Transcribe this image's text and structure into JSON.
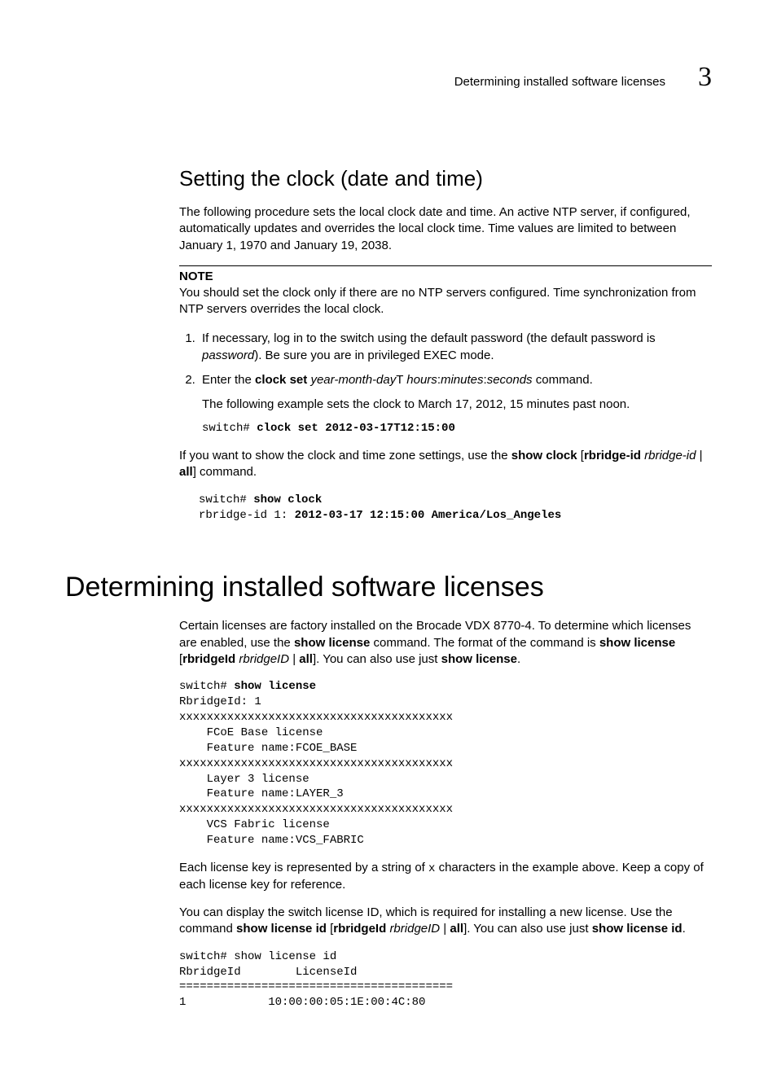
{
  "header": {
    "running_title": "Determining installed software licenses",
    "chapter_number": "3"
  },
  "subsection": {
    "title": "Setting the clock (date and time)",
    "intro": "The following procedure sets the local clock date and time. An active NTP server, if configured, automatically updates and overrides the local clock time. Time values are limited to between January 1, 1970 and January 19, 2038.",
    "note_label": "NOTE",
    "note_body": "You should set the clock only if there are no NTP servers configured. Time synchronization from NTP servers overrides the local clock.",
    "step1_a": "If necessary, log in to the switch using the default password (the default password is ",
    "step1_pw": "password",
    "step1_b": "). Be sure you are in privileged EXEC mode.",
    "step2_a": "Enter the ",
    "step2_cmd": "clock set",
    "step2_b": " ",
    "step2_arg1": "year-month-day",
    "step2_T": "T ",
    "step2_arg2": "hours",
    "step2_colon1": ":",
    "step2_arg3": "minutes",
    "step2_colon2": ":",
    "step2_arg4": "seconds",
    "step2_c": " command.",
    "step2_example_text": "The following example sets the clock to March 17, 2012, 15 minutes past noon.",
    "code1_prompt": "switch# ",
    "code1_cmd": "clock set 2012-03-17T12:15:00",
    "after_a": "If you want to show the clock and time zone settings, use the ",
    "after_cmd": "show clock",
    "after_b": " [",
    "after_rb": "rbridge-id",
    "after_sp": " ",
    "after_rbid_i": "rbridge-id",
    "after_pipe": " | ",
    "after_all": "all",
    "after_c": "] command.",
    "code2_prompt": "switch# ",
    "code2_cmd": "show clock",
    "code2_line2a": "rbridge-id 1: ",
    "code2_line2b": "2012-03-17 12:15:00 America/Los_Angeles"
  },
  "section": {
    "title": "Determining installed software licenses",
    "p1_a": "Certain licenses are factory installed on the Brocade VDX 8770-4. To determine which licenses are enabled, use the ",
    "p1_cmd1": "show license",
    "p1_b": " command. The format of the command is ",
    "p1_cmd2": "show license",
    "p1_c": " [",
    "p1_rb": "rbridgeId",
    "p1_sp": " ",
    "p1_rbid_i": "rbridgeID",
    "p1_pipe": " | ",
    "p1_all": "all",
    "p1_d": "]. You can also use just ",
    "p1_cmd3": "show license",
    "p1_e": ".",
    "code3_prompt": "switch# ",
    "code3_cmd": "show license",
    "code3_body": "RbridgeId: 1\nxxxxxxxxxxxxxxxxxxxxxxxxxxxxxxxxxxxxxxxx\n    FCoE Base license\n    Feature name:FCOE_BASE\nxxxxxxxxxxxxxxxxxxxxxxxxxxxxxxxxxxxxxxxx\n    Layer 3 license\n    Feature name:LAYER_3\nxxxxxxxxxxxxxxxxxxxxxxxxxxxxxxxxxxxxxxxx\n    VCS Fabric license\n    Feature name:VCS_FABRIC",
    "p2_a": "Each license key is represented by a string of ",
    "p2_x": "x",
    "p2_b": " characters in the example above. Keep a copy of each license key for reference.",
    "p3_a": "You can display the switch license ID, which is required for installing a new license. Use the command ",
    "p3_cmd1": "show license id",
    "p3_b": " [",
    "p3_rb": "rbridgeId",
    "p3_sp": " ",
    "p3_rbid_i": "rbridgeID",
    "p3_pipe": " | ",
    "p3_all": "all",
    "p3_c": "]. You can also use just ",
    "p3_cmd2": "show license id",
    "p3_d": ".",
    "code4": "switch# show license id\nRbridgeId        LicenseId\n========================================\n1            10:00:00:05:1E:00:4C:80"
  }
}
